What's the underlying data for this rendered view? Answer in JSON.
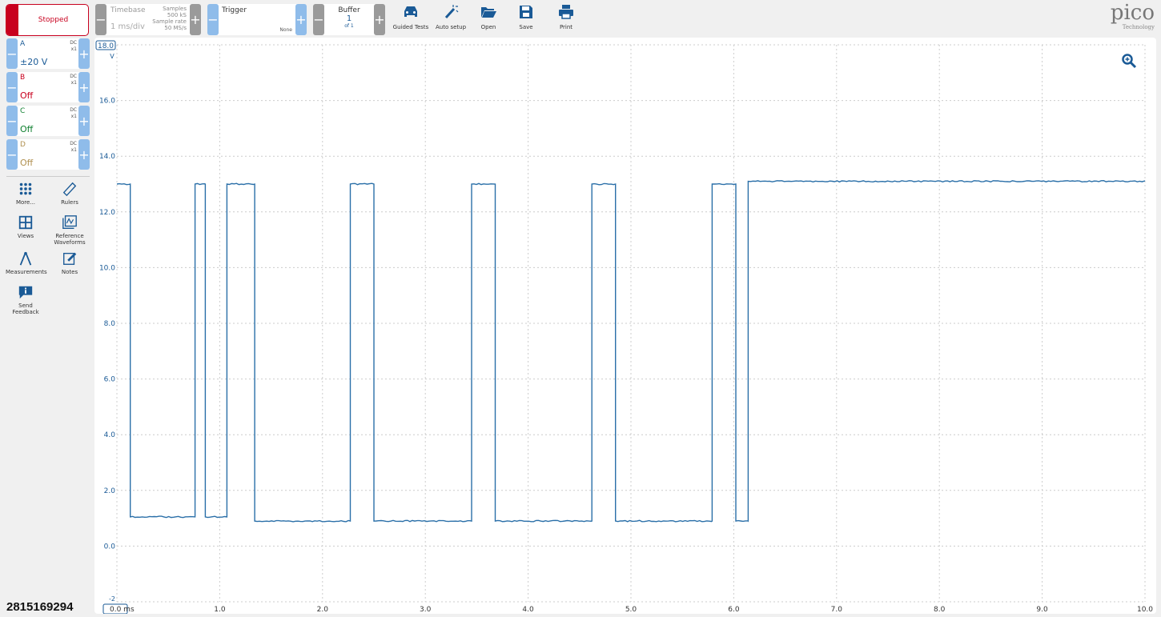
{
  "status": {
    "label": "Stopped",
    "color": "#c8001e"
  },
  "timebase": {
    "title": "Timebase",
    "value": "1 ms/div",
    "samples_label": "Samples",
    "samples": "500 kS",
    "rate_label": "Sample rate",
    "rate": "50 MS/s"
  },
  "trigger": {
    "title": "Trigger",
    "mode": "None"
  },
  "buffer": {
    "title": "Buffer",
    "value": "1",
    "of": "of 1"
  },
  "toolbar": [
    {
      "label": "Guided Tests",
      "icon": "car-icon"
    },
    {
      "label": "Auto setup",
      "icon": "magic-wand-icon"
    },
    {
      "label": "Open",
      "icon": "folder-open-icon"
    },
    {
      "label": "Save",
      "icon": "save-icon"
    },
    {
      "label": "Print",
      "icon": "printer-icon"
    }
  ],
  "logo": {
    "text": "pico",
    "sub": "Technology"
  },
  "channels": [
    {
      "name": "A",
      "coupling": "DC",
      "probe": "x1",
      "range": "±20 V",
      "color": "#1a5a96"
    },
    {
      "name": "B",
      "coupling": "DC",
      "probe": "x1",
      "range": "Off",
      "color": "#c8001e"
    },
    {
      "name": "C",
      "coupling": "DC",
      "probe": "x1",
      "range": "Off",
      "color": "#108030"
    },
    {
      "name": "D",
      "coupling": "DC",
      "probe": "x1",
      "range": "Off",
      "color": "#b09050"
    }
  ],
  "side_tools": [
    {
      "label": "More...",
      "icon": "grid-dots-icon"
    },
    {
      "label": "Rulers",
      "icon": "ruler-icon"
    },
    {
      "label": "Views",
      "icon": "views-icon"
    },
    {
      "label": "Reference Waveforms",
      "icon": "reference-waveform-icon"
    },
    {
      "label": "Measurements",
      "icon": "compass-icon"
    },
    {
      "label": "Notes",
      "icon": "notes-icon"
    },
    {
      "label": "Send Feedback",
      "icon": "feedback-icon"
    }
  ],
  "footer_id": "2815169294",
  "chart_data": {
    "type": "line",
    "xlabel": "ms",
    "ylabel": "V",
    "xlim": [
      0,
      10
    ],
    "ylim": [
      -2,
      18
    ],
    "xticks": [
      "0.0",
      "1.0",
      "2.0",
      "3.0",
      "4.0",
      "5.0",
      "6.0",
      "7.0",
      "8.0",
      "9.0",
      "10.0"
    ],
    "yticks": [
      "-2",
      "0.0",
      "2.0",
      "4.0",
      "6.0",
      "8.0",
      "10.0",
      "12.0",
      "14.0",
      "16.0",
      "18.0"
    ],
    "grid": true,
    "series_color": "#2a6fa8",
    "segments": [
      {
        "from": 0,
        "to": 0.13,
        "v": 13.0
      },
      {
        "from": 0.13,
        "to": 0.76,
        "v": 1.05
      },
      {
        "from": 0.76,
        "to": 0.86,
        "v": 13.0
      },
      {
        "from": 0.86,
        "to": 1.07,
        "v": 1.05
      },
      {
        "from": 1.07,
        "to": 1.34,
        "v": 13.0
      },
      {
        "from": 1.34,
        "to": 2.27,
        "v": 0.9
      },
      {
        "from": 2.27,
        "to": 2.5,
        "v": 13.0
      },
      {
        "from": 2.5,
        "to": 3.45,
        "v": 0.9
      },
      {
        "from": 3.45,
        "to": 3.68,
        "v": 13.0
      },
      {
        "from": 3.68,
        "to": 4.62,
        "v": 0.9
      },
      {
        "from": 4.62,
        "to": 4.85,
        "v": 13.0
      },
      {
        "from": 4.85,
        "to": 5.79,
        "v": 0.9
      },
      {
        "from": 5.79,
        "to": 6.02,
        "v": 13.0
      },
      {
        "from": 6.02,
        "to": 6.14,
        "v": 0.9
      },
      {
        "from": 6.14,
        "to": 10,
        "v": 13.1
      }
    ]
  }
}
